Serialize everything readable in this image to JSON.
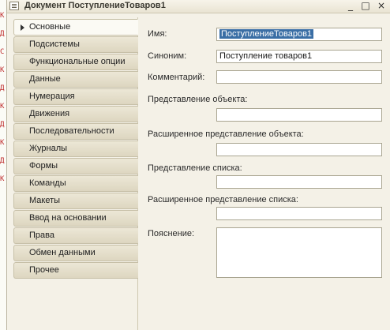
{
  "left_strip": {
    "glyphs": [
      "К",
      "Д",
      "С",
      "К",
      "Д",
      "К",
      "Д",
      "К",
      "Д",
      "К"
    ]
  },
  "window": {
    "title": "Документ ПоступлениеТоваров1",
    "controls": {
      "minimize": "_",
      "maximize": "□",
      "close": "×"
    }
  },
  "tabs": [
    {
      "label": "Основные",
      "active": true
    },
    {
      "label": "Подсистемы"
    },
    {
      "label": "Функциональные опции"
    },
    {
      "label": "Данные"
    },
    {
      "label": "Нумерация"
    },
    {
      "label": "Движения"
    },
    {
      "label": "Последовательности"
    },
    {
      "label": "Журналы"
    },
    {
      "label": "Формы"
    },
    {
      "label": "Команды"
    },
    {
      "label": "Макеты"
    },
    {
      "label": "Ввод на основании"
    },
    {
      "label": "Права"
    },
    {
      "label": "Обмен данными"
    },
    {
      "label": "Прочее"
    }
  ],
  "form": {
    "name_label": "Имя:",
    "name_value": "ПоступлениеТоваров1",
    "synonym_label": "Синоним:",
    "synonym_value": "Поступление товаров1",
    "comment_label": "Комментарий:",
    "comment_value": "",
    "object_presentation_label": "Представление объекта:",
    "object_presentation_value": "",
    "ext_object_presentation_label": "Расширенное представление объекта:",
    "ext_object_presentation_value": "",
    "list_presentation_label": "Представление списка:",
    "list_presentation_value": "",
    "ext_list_presentation_label": "Расширенное представление списка:",
    "ext_list_presentation_value": "",
    "explanation_label": "Пояснение:",
    "explanation_value": ""
  }
}
